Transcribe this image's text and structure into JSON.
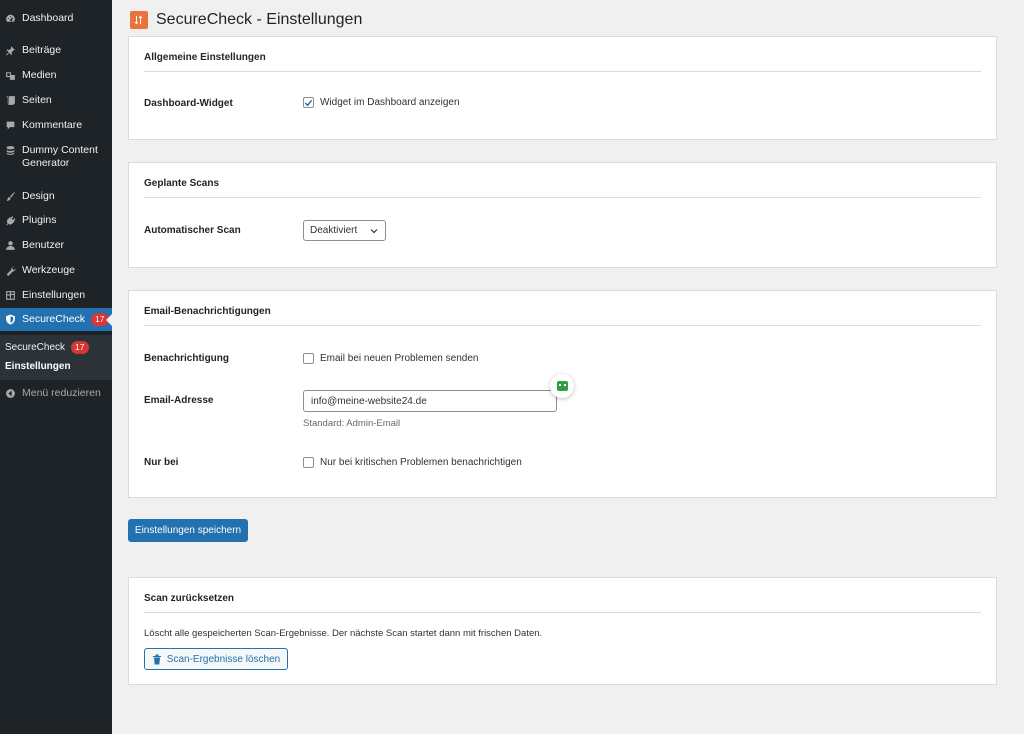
{
  "sidebar": {
    "items": [
      {
        "label": "Dashboard",
        "icon": "dashboard-icon"
      },
      {
        "label": "Beiträge",
        "icon": "pin-icon"
      },
      {
        "label": "Medien",
        "icon": "media-icon"
      },
      {
        "label": "Seiten",
        "icon": "pages-icon"
      },
      {
        "label": "Kommentare",
        "icon": "comments-icon"
      },
      {
        "label": "Dummy Content Generator",
        "icon": "database-icon"
      },
      {
        "label": "Design",
        "icon": "brush-icon"
      },
      {
        "label": "Plugins",
        "icon": "plugin-icon"
      },
      {
        "label": "Benutzer",
        "icon": "user-icon"
      },
      {
        "label": "Werkzeuge",
        "icon": "wrench-icon"
      },
      {
        "label": "Einstellungen",
        "icon": "settings-icon"
      },
      {
        "label": "SecureCheck",
        "icon": "shield-icon",
        "badge": "17"
      }
    ],
    "submenu": [
      {
        "label": "SecureCheck",
        "badge": "17"
      },
      {
        "label": "Einstellungen"
      }
    ],
    "collapse_label": "Menü reduzieren"
  },
  "header": {
    "title": "SecureCheck - Einstellungen",
    "logo": "securecheck-logo-icon"
  },
  "general": {
    "title": "Allgemeine Einstellungen",
    "dashboard_widget_label": "Dashboard-Widget",
    "dashboard_widget_checkbox": "Widget im Dashboard anzeigen",
    "dashboard_widget_checked": true
  },
  "scans": {
    "title": "Geplante Scans",
    "auto_scan_label": "Automatischer Scan",
    "auto_scan_value": "Deaktiviert"
  },
  "email": {
    "title": "Email-Benachrichtigungen",
    "notify_label": "Benachrichtigung",
    "notify_checkbox": "Email bei neuen Problemen senden",
    "notify_checked": false,
    "address_label": "Email-Adresse",
    "address_value": "info@meine-website24.de",
    "address_help": "Standard: Admin-Email",
    "only_label": "Nur bei",
    "only_checkbox": "Nur bei kritischen Problemen benachrichtigen",
    "only_checked": false
  },
  "save_button": "Einstellungen speichern",
  "reset": {
    "title": "Scan zurücksetzen",
    "description": "Löscht alle gespeicherten Scan-Ergebnisse. Der nächste Scan startet dann mit frischen Daten.",
    "button": "Scan-Ergebnisse löschen"
  },
  "colors": {
    "accent": "#2271b1",
    "sidebar": "#1d2327",
    "badge": "#d63638",
    "logo": "#e9733c"
  }
}
